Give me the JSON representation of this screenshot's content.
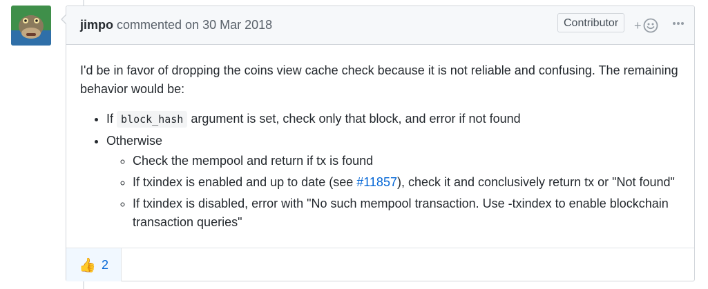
{
  "comment": {
    "author": "jimpo",
    "action": "commented on",
    "date": "30 Mar 2018",
    "badge": "Contributor",
    "add_reaction_plus": "+",
    "intro": "I'd be in favor of dropping the coins view cache check because it is not reliable and confusing. The remaining behavior would be:",
    "items": [
      {
        "prefix": "If",
        "code": "block_hash",
        "suffix": "argument is set, check only that block, and error if not found"
      },
      {
        "label": "Otherwise",
        "subitems": [
          {
            "text": "Check the mempool and return if tx is found"
          },
          {
            "before": "If txindex is enabled and up to date (see ",
            "link": "#11857",
            "after": "), check it and conclusively return tx or \"Not found\""
          },
          {
            "text": "If txindex is disabled, error with \"No such mempool transaction. Use -txindex to enable blockchain transaction queries\""
          }
        ]
      }
    ],
    "reactions": [
      {
        "icon": "thumbs-up-icon",
        "emoji": "👍",
        "count": "2"
      }
    ]
  },
  "colors": {
    "link": "#0366d6",
    "header_bg": "#f6f8fa",
    "border": "#d1d5da",
    "reaction_bg": "#f1f8ff"
  }
}
